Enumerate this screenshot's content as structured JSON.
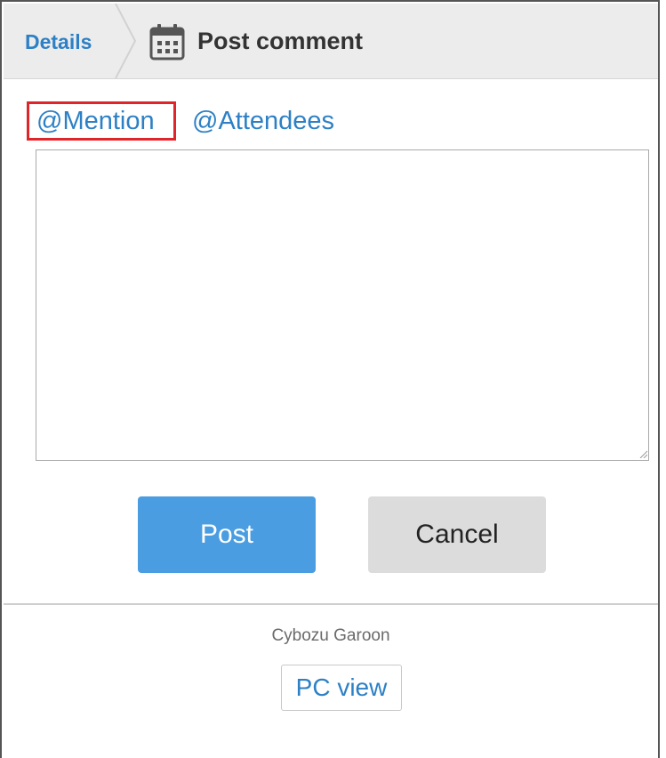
{
  "header": {
    "breadcrumb_label": "Details",
    "title": "Post comment",
    "title_icon": "calendar-icon"
  },
  "mentions": {
    "mention_label": "@Mention",
    "attendees_label": "@Attendees"
  },
  "comment": {
    "value": "",
    "placeholder": ""
  },
  "actions": {
    "post_label": "Post",
    "cancel_label": "Cancel"
  },
  "footer": {
    "brand": "Cybozu Garoon",
    "pc_view_label": "PC view"
  },
  "colors": {
    "link": "#2d80c5",
    "primary_button": "#4a9de0",
    "secondary_button": "#dcdcdc",
    "highlight_border": "#e0252a",
    "header_bg": "#ececec"
  }
}
